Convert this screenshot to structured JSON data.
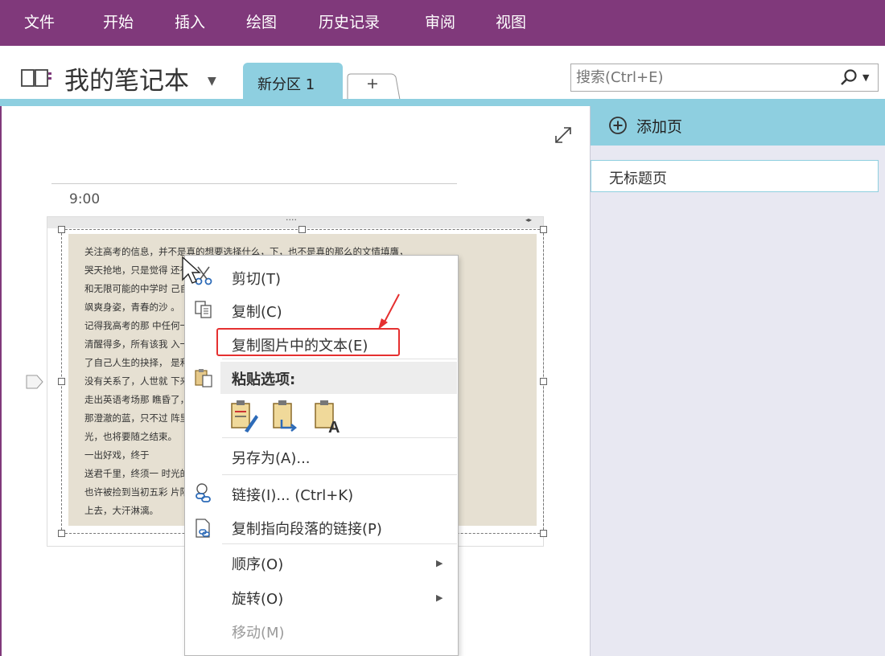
{
  "menubar": {
    "items": [
      "文件",
      "开始",
      "插入",
      "绘图",
      "历史记录",
      "审阅",
      "视图"
    ]
  },
  "notebook": {
    "title": "我的笔记本",
    "active_section": "新分区 1",
    "add_section_label": "+"
  },
  "search": {
    "placeholder": "搜索(Ctrl+E)"
  },
  "page_pane": {
    "add_page_label": "添加页",
    "pages": [
      "无标题页"
    ]
  },
  "note": {
    "time": "9:00",
    "image_text_lines": [
      "关注高考的信息，并不是真的想要选择什么，下，也不是真的那么的文情填膺，",
      "哭天抢地，只是觉得                                                    还有很多选择",
      "和无限可能的中学时                                                    己自己当年的",
      "飒爽身姿，青春的沙                                                    。",
      "    记得我高考的那                                                    中任何一天都",
      "清醒得多，所有该我                                                    入一起，做出",
      "了自己人生的抉择，                                                    是和之前的都",
      "没有关系了，人世就                                                    下来。",
      "    走出英语考场那                                                    瞧昏了，还是",
      "那澄澈的蓝，只不过                                                    阵里的一段时",
      "光，也将要随之结束。",
      "    一出好戏，终于",
      "    送君千里，终须一                                                  时光的海岸，",
      "也许被捡到当初五彩                                                    片陌生的砂石",
      "上去，大汗淋漓。"
    ]
  },
  "context_menu": {
    "cut": "剪切(T)",
    "copy": "复制(C)",
    "copy_text_from_picture": "复制图片中的文本(E)",
    "paste_options": "粘贴选项:",
    "save_as": "另存为(A)...",
    "link": "链接(I)... (Ctrl+K)",
    "copy_link_to_paragraph": "复制指向段落的链接(P)",
    "order": "顺序(O)",
    "rotate": "旋转(O)",
    "move": "移动(M)"
  },
  "colors": {
    "ribbon_purple": "#80397b",
    "section_blue": "#8ecfe0",
    "page_pane_bg": "#e8e8f2",
    "highlight_red": "#e53030"
  }
}
